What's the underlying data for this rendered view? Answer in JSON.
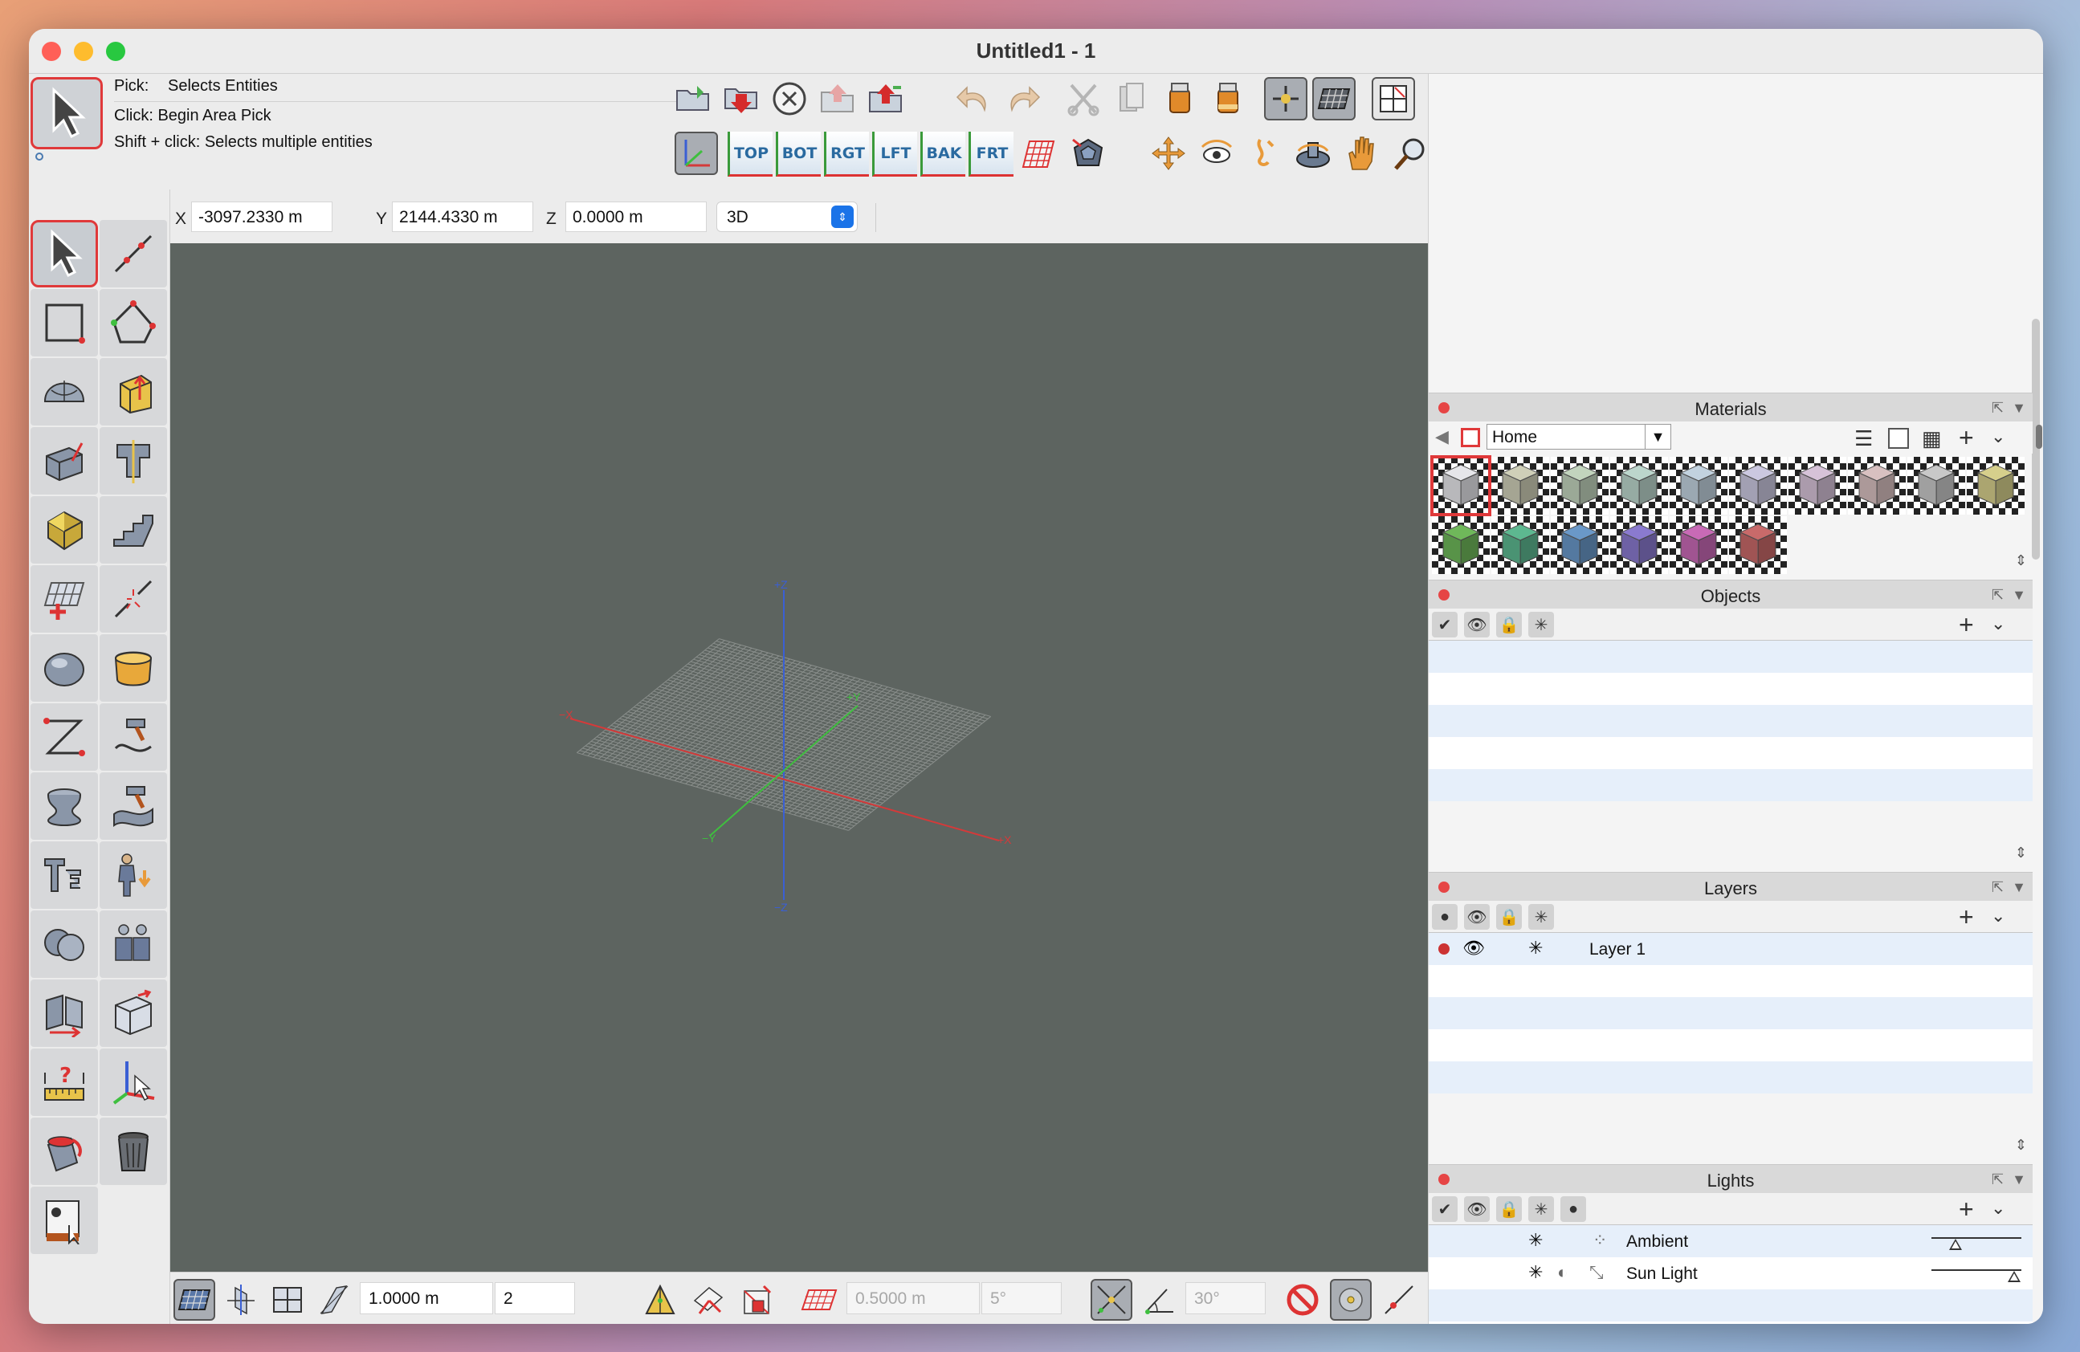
{
  "window": {
    "title": "Untitled1 - 1"
  },
  "hints": {
    "pick_label": "Pick:",
    "pick_value": "Selects Entities",
    "click": "Click: Begin Area Pick",
    "shift_click": "Shift + click: Selects multiple entities"
  },
  "view_buttons": [
    "TOP",
    "BOT",
    "RGT",
    "LFT",
    "BAK",
    "FRT"
  ],
  "coords": {
    "x_label": "X",
    "x_value": "-3097.2330 m",
    "y_label": "Y",
    "y_value": "2144.4330 m",
    "z_label": "Z",
    "z_value": "0.0000 m",
    "view_mode": "3D"
  },
  "viewport": {
    "axis_labels": {
      "pos_z": "+Z",
      "neg_z": "−Z",
      "pos_y": "+Y",
      "neg_y": "−Y",
      "pos_x": "+X",
      "neg_x": "−X"
    },
    "colors": {
      "background": "#5d6460",
      "x_axis": "#d43a3a",
      "y_axis": "#3fbf3f",
      "z_axis": "#3a5fd4",
      "grid": "#8a8f8c"
    }
  },
  "bottombar": {
    "grid_spacing": "1.0000 m",
    "grid_subdiv": "2",
    "snap_distance": "0.5000 m",
    "snap_angle": "5°",
    "angle_constraint": "30°"
  },
  "panels": {
    "materials": {
      "title": "Materials",
      "library": "Home",
      "swatch_colors": [
        "#e6e6ea",
        "#cfcfb8",
        "#c2d4bd",
        "#bcd6cc",
        "#c2d2df",
        "#cbc8e0",
        "#d6c2d8",
        "#d8c0c0",
        "#c8c8c8",
        "#d6cf8c",
        "#6fb85a",
        "#5db890",
        "#6a98c8",
        "#8a7acf",
        "#c86ab6",
        "#c86a6a"
      ]
    },
    "objects": {
      "title": "Objects"
    },
    "layers": {
      "title": "Layers",
      "items": [
        {
          "name": "Layer 1"
        }
      ]
    },
    "lights": {
      "title": "Lights",
      "items": [
        {
          "name": "Ambient",
          "level": 0.27
        },
        {
          "name": "Sun Light",
          "level": 0.92
        }
      ]
    }
  }
}
